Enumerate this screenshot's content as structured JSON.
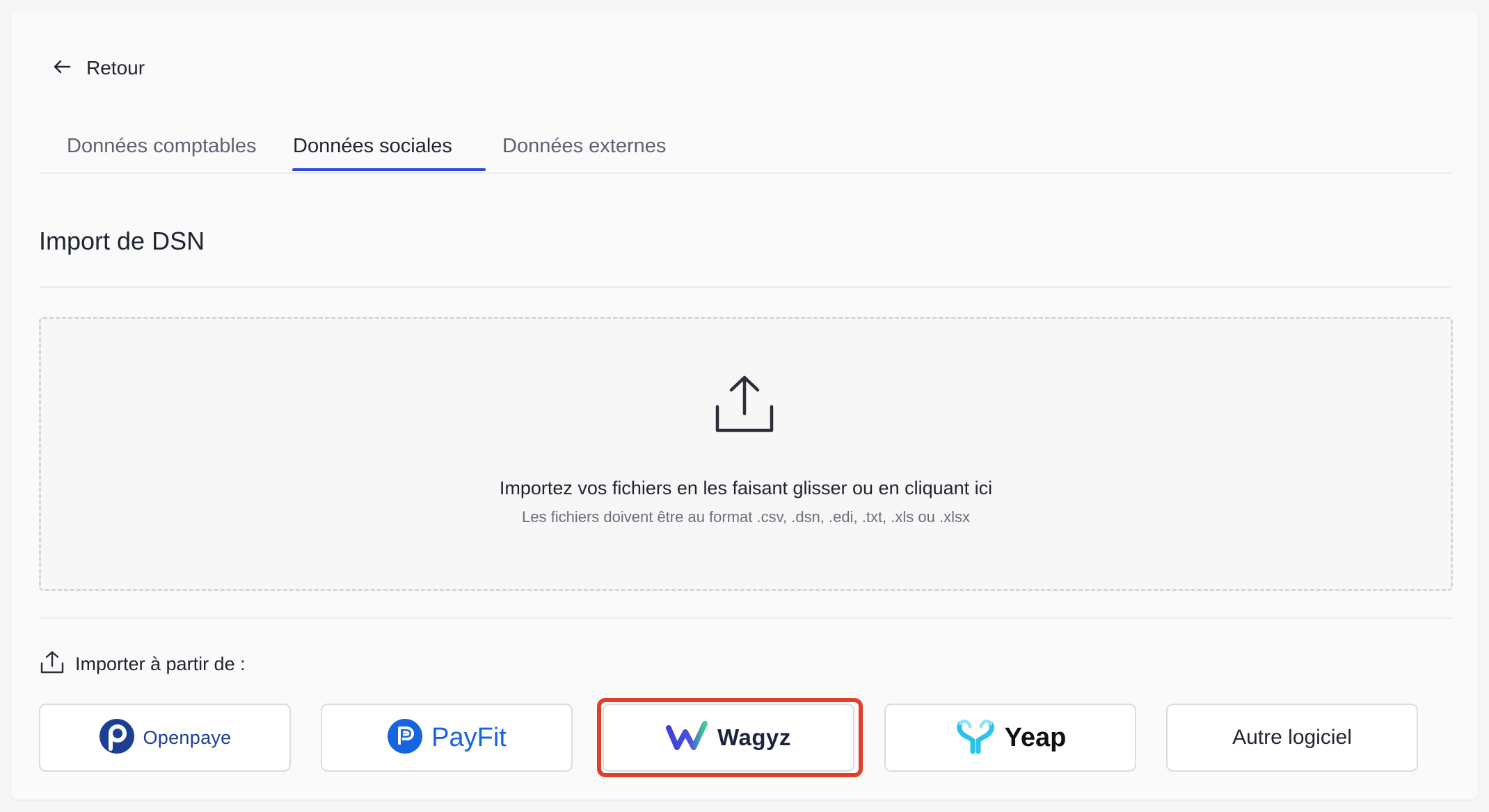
{
  "nav": {
    "back_label": "Retour"
  },
  "tabs": [
    {
      "label": "Données comptables",
      "active": false
    },
    {
      "label": "Données sociales",
      "active": true
    },
    {
      "label": "Données externes",
      "active": false
    }
  ],
  "section": {
    "title": "Import de DSN"
  },
  "dropzone": {
    "main_text": "Importez vos fichiers en les faisant glisser ou en cliquant ici",
    "sub_text": "Les fichiers doivent être au format .csv, .dsn, .edi, .txt, .xls ou .xlsx"
  },
  "import_from": {
    "label": "Importer à partir de :"
  },
  "providers": [
    {
      "name": "Openpaye",
      "icon": "openpaye-logo-icon"
    },
    {
      "name": "PayFit",
      "icon": "payfit-logo-icon"
    },
    {
      "name": "Wagyz",
      "icon": "wagyz-logo-icon",
      "highlighted": true
    },
    {
      "name": "Yeap",
      "icon": "yeap-logo-icon"
    },
    {
      "name": "Autre logiciel"
    }
  ],
  "colors": {
    "accent": "#2b4bd6",
    "highlight": "#e0402a",
    "openpaye": "#1c3f94",
    "payfit": "#1565e0",
    "wagyz_start": "#3b3fd8",
    "wagyz_end": "#3fd38a",
    "yeap": "#2bc3e8"
  }
}
